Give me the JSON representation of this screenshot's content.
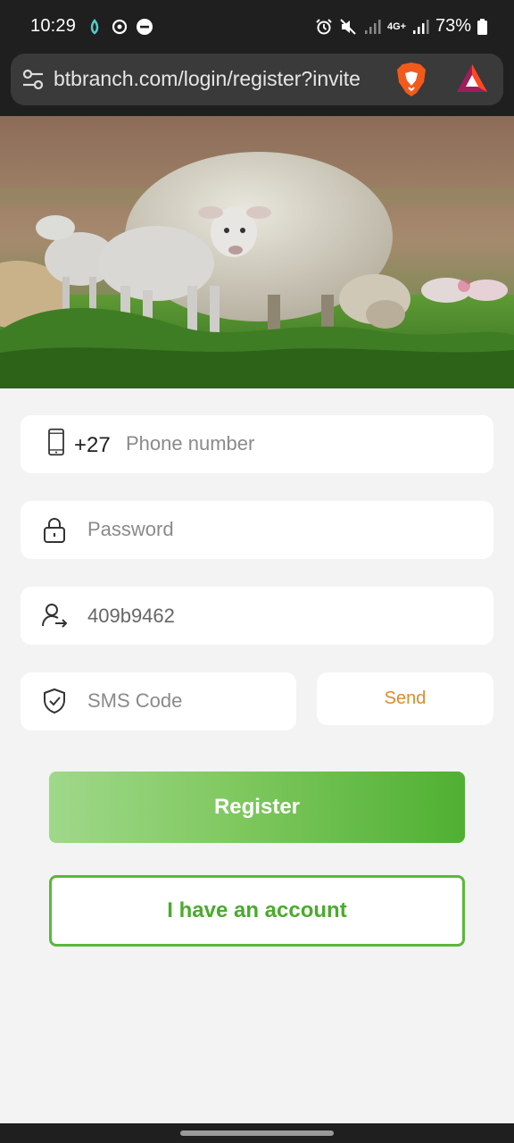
{
  "status_bar": {
    "time": "10:29",
    "network": "4G+",
    "battery": "73%"
  },
  "browser": {
    "url": "btbranch.com/login/register?invite",
    "icons": [
      "tune-icon",
      "brave-lion-icon",
      "bat-rewards-icon"
    ]
  },
  "hero": {
    "image_desc_icon": "sheep-photo"
  },
  "form": {
    "phone": {
      "country_code": "+27",
      "placeholder": "Phone number",
      "icon": "phone-icon"
    },
    "password": {
      "placeholder": "Password",
      "icon": "lock-icon"
    },
    "invite": {
      "value": "409b9462",
      "icon": "user-arrow-icon"
    },
    "sms": {
      "placeholder": "SMS Code",
      "icon": "shield-check-icon"
    },
    "send_label": "Send",
    "register_label": "Register",
    "account_label": "I have an account"
  },
  "colors": {
    "accent_green": "#4fb032",
    "send_orange": "#e08a2c",
    "background": "#f3f3f3"
  }
}
